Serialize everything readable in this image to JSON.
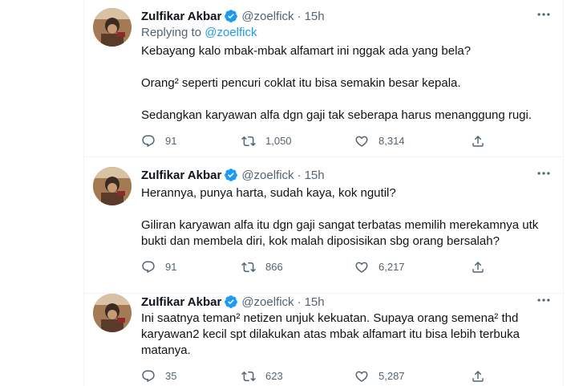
{
  "tweets": [
    {
      "name": "Zulfikar Akbar",
      "handle": "@zoelfick",
      "time": "15h",
      "replying_label": "Replying to",
      "replying_to": "@zoelfick",
      "paragraphs": [
        "Kebayang kalo mbak-mbak alfamart ini nggak ada yang bela?",
        "Orang² seperti pencuri coklat itu bisa semakin besar kepala.",
        "Sedangkan karyawan alfa dgn gaji tak seberapa harus menanggung rugi."
      ],
      "replies": "91",
      "retweets": "1,050",
      "likes": "8,314"
    },
    {
      "name": "Zulfikar Akbar",
      "handle": "@zoelfick",
      "time": "15h",
      "paragraphs": [
        "Herannya, punya harta, sudah kaya, kok ngutil?",
        "Giliran karyawan alfa itu dgn gaji sangat terbatas memilih merekamnya utk bukti dan membela diri, kok malah diposisikan sbg orang bersalah?"
      ],
      "replies": "91",
      "retweets": "866",
      "likes": "6,217"
    },
    {
      "name": "Zulfikar Akbar",
      "handle": "@zoelfick",
      "time": "15h",
      "paragraphs": [
        "Ini saatnya teman² netizen unjuk kekuatan. Supaya orang semena² thd karyawan2 kecil spt dilakukan atas mbak alfamart itu bisa lebih terbuka matanya."
      ],
      "replies": "35",
      "retweets": "623",
      "likes": "5,287"
    }
  ],
  "icons": {
    "verified": "verified-badge-icon",
    "more": "more-options-icon",
    "reply": "reply-icon",
    "retweet": "retweet-icon",
    "like": "like-icon",
    "share": "share-icon"
  },
  "colors": {
    "accent": "#1d9bf0",
    "secondary_text": "#536471",
    "primary_text": "#0f1419",
    "divider": "#eff3f4"
  }
}
